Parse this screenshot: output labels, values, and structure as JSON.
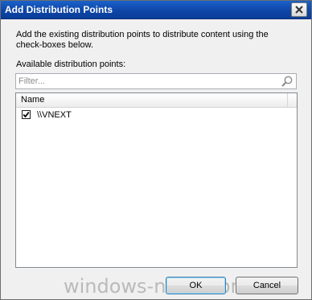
{
  "window": {
    "title": "Add Distribution Points"
  },
  "description": "Add the existing distribution points to distribute content using the check-boxes below.",
  "available_label": "Available distribution points:",
  "filter": {
    "placeholder": "Filter...",
    "value": ""
  },
  "list": {
    "columns": [
      "Name"
    ],
    "items": [
      {
        "name": "\\\\VNEXT",
        "checked": true
      }
    ]
  },
  "buttons": {
    "ok": "OK",
    "cancel": "Cancel"
  },
  "watermark": "windows-noob.com",
  "colors": {
    "titlebar": "#0e46a8",
    "dialog_bg": "#f0f0f0"
  }
}
